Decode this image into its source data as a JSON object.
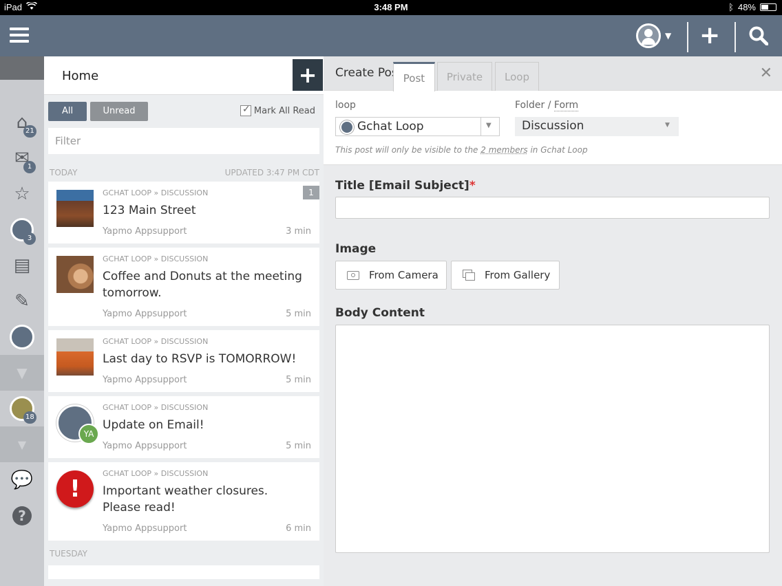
{
  "status": {
    "device": "iPad",
    "time": "3:48 PM",
    "battery": "48%",
    "battery_level": 0.48
  },
  "nav": {
    "counts": {
      "home": "21",
      "mail": "1",
      "loop": "3",
      "folder": "18"
    }
  },
  "list": {
    "title": "Home",
    "filter_all": "All",
    "filter_unread": "Unread",
    "mark_all_read": "Mark All Read",
    "filter_placeholder": "Filter",
    "section_today": "TODAY",
    "updated": "UPDATED 3:47 PM CDT",
    "section_tuesday": "TUESDAY",
    "items": [
      {
        "meta": "GCHAT LOOP » DISCUSSION",
        "title": "123 Main Street",
        "author": "Yapmo Appsupport",
        "time": "3 min",
        "count": "1"
      },
      {
        "meta": "GCHAT LOOP » DISCUSSION",
        "title": "Coffee and Donuts at the meeting tomorrow.",
        "author": "Yapmo Appsupport",
        "time": "5 min"
      },
      {
        "meta": "GCHAT LOOP » DISCUSSION",
        "title": "Last day to RSVP is TOMORROW!",
        "author": "Yapmo Appsupport",
        "time": "5 min"
      },
      {
        "meta": "GCHAT LOOP » DISCUSSION",
        "title": "Update on Email!",
        "author": "Yapmo Appsupport",
        "time": "5 min",
        "initials": "YA"
      },
      {
        "meta": "GCHAT LOOP » DISCUSSION",
        "title": "Important weather closures. Please read!",
        "author": "Yapmo Appsupport",
        "time": "6 min"
      }
    ]
  },
  "form": {
    "header": "Create Post",
    "tabs": [
      "Post",
      "Private",
      "Loop"
    ],
    "loop_label": "loop",
    "loop_value": "Gchat Loop",
    "folder_label_1": "Folder",
    "folder_sep": " / ",
    "folder_label_2": "Form",
    "folder_value": "Discussion",
    "note_pre": "This post will only be visible to the ",
    "note_link": "2 members",
    "note_post": " in Gchat Loop",
    "title_label": "Title [Email Subject]",
    "required_mark": "*",
    "image_label": "Image",
    "from_camera": "From Camera",
    "from_gallery": "From Gallery",
    "body_label": "Body Content"
  }
}
